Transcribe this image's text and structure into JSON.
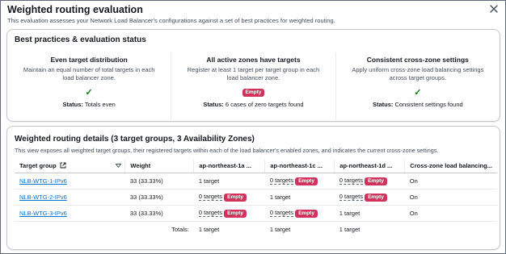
{
  "modal": {
    "title": "Weighted routing evaluation",
    "subtitle": "This evaluation assesses your Network Load Balancer's configurations against a set of best practices for weighted routing."
  },
  "best_practices": {
    "title": "Best practices & evaluation status",
    "status_label": "Status:",
    "items": [
      {
        "title": "Even target distribution",
        "description": "Maintain an equal number of total targets in each load balancer zone.",
        "mark": "check-icon",
        "status": "Totals even"
      },
      {
        "title": "All active zones have targets",
        "description": "Register at least 1 target per target group in each load balancer zone.",
        "mark": "Empty",
        "status": "6 cases of zero targets found"
      },
      {
        "title": "Consistent cross-zone settings",
        "description": "Apply uniform cross-zone load balancing settings across target groups.",
        "mark": "check-icon",
        "status": "Consistent settings found"
      }
    ]
  },
  "details": {
    "title": "Weighted routing details (3 target groups, 3 Availability Zones)",
    "description": "This view exposes all weighted target groups, their registered targets within each of the load balancer's enabled zones, and indicates the current cross-zone settings.",
    "columns": {
      "target_group": "Target group",
      "weight": "Weight",
      "zone_a": "ap-northeast-1a ...",
      "zone_c": "ap-northeast-1c ...",
      "zone_d": "ap-northeast-1d ...",
      "cross_zone": "Cross-zone load balancing..."
    },
    "empty_badge": "Empty",
    "rows": [
      {
        "name": "NLB-WTG-1-IPv6",
        "weight": "33 (33.33%)",
        "zone_a": "1 target",
        "zone_c": "0 targets",
        "zone_d": "0 targets",
        "cross_zone": "On"
      },
      {
        "name": "NLB-WTG-2-IPv6",
        "weight": "33 (33.33%)",
        "zone_a": "0 targets",
        "zone_c": "1 target",
        "zone_d": "0 targets",
        "cross_zone": "On"
      },
      {
        "name": "NLB-WTG-3-IPv6",
        "weight": "33 (33.33%)",
        "zone_a": "0 targets",
        "zone_c": "0 targets",
        "zone_d": "1 target",
        "cross_zone": "On"
      }
    ],
    "totals": {
      "label": "Totals:",
      "zone_a": "1 target",
      "zone_c": "1 target",
      "zone_d": "1 target"
    }
  },
  "colors": {
    "link": "#0972d3",
    "badge": "#d1325b",
    "success": "#037f0c"
  }
}
